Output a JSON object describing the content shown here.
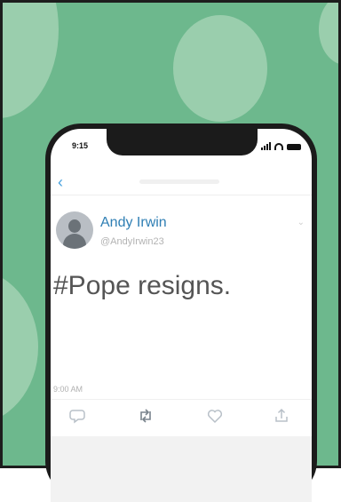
{
  "status_bar": {
    "time": "9:15"
  },
  "tweet": {
    "author_name": "Andy Irwin",
    "handle": "@AndyIrwin23",
    "text": "#Pope resigns.",
    "timestamp": "9:00 AM"
  },
  "icons": {
    "back": "chevron-left-icon",
    "more": "chevron-down-icon",
    "actions": [
      "reply-icon",
      "retweet-icon",
      "like-icon",
      "share-icon"
    ]
  },
  "colors": {
    "background": "#6db88d",
    "blobs": "#a9d6b8",
    "accent": "#4aa3df",
    "author_name": "#2f7fb4",
    "tweet_text": "#555555",
    "phone_frame": "#1b1b1b"
  }
}
